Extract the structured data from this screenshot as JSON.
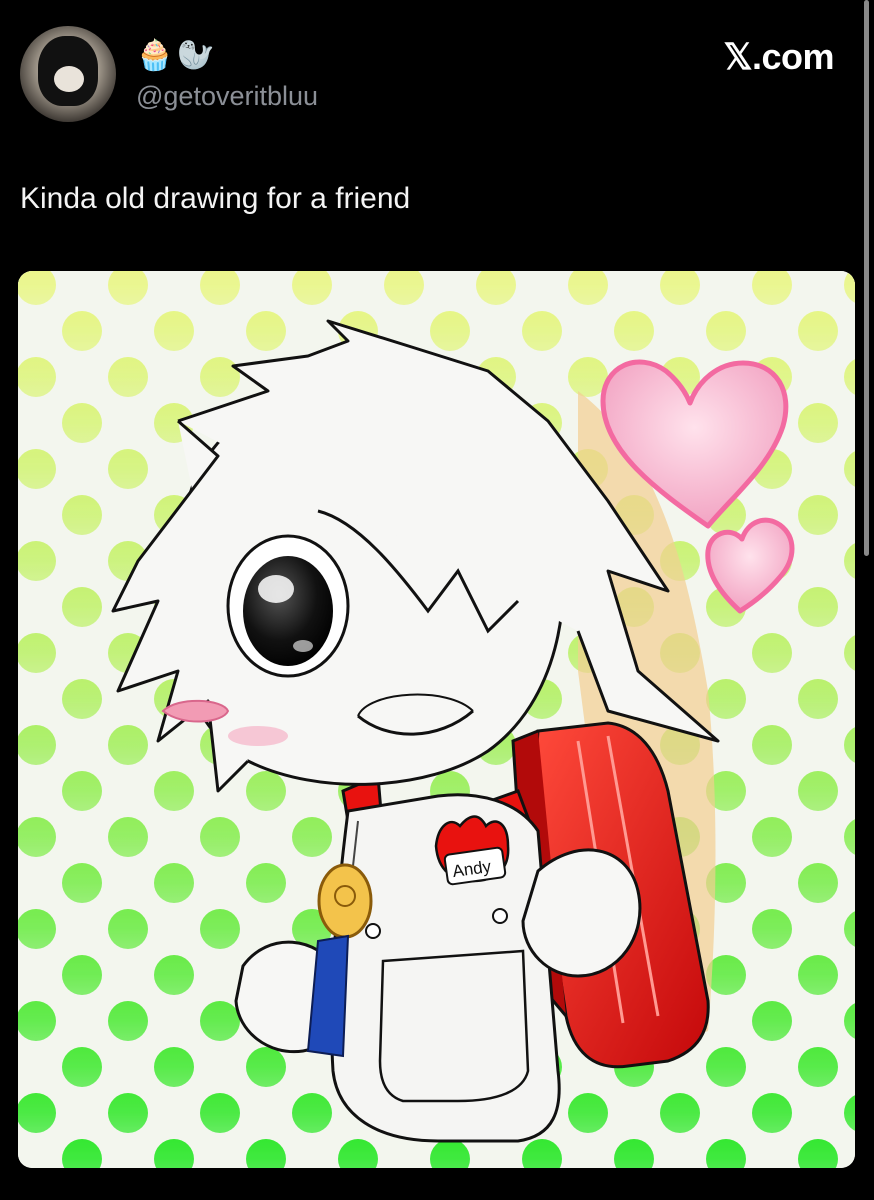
{
  "user": {
    "handle": "@getoveritbluu",
    "name_emojis": [
      "🧁",
      "🦭"
    ],
    "avatar_icon": "profile-avatar"
  },
  "brand": {
    "label": "𝕏.com"
  },
  "tweet": {
    "text": "Kinda old drawing for a friend"
  },
  "media": {
    "badge_text": "Andy",
    "colors": {
      "dots_top": "#e6f57e",
      "dots_bottom": "#21e81e",
      "bag": "#e8120f",
      "heart": "#f6a9c6"
    }
  }
}
